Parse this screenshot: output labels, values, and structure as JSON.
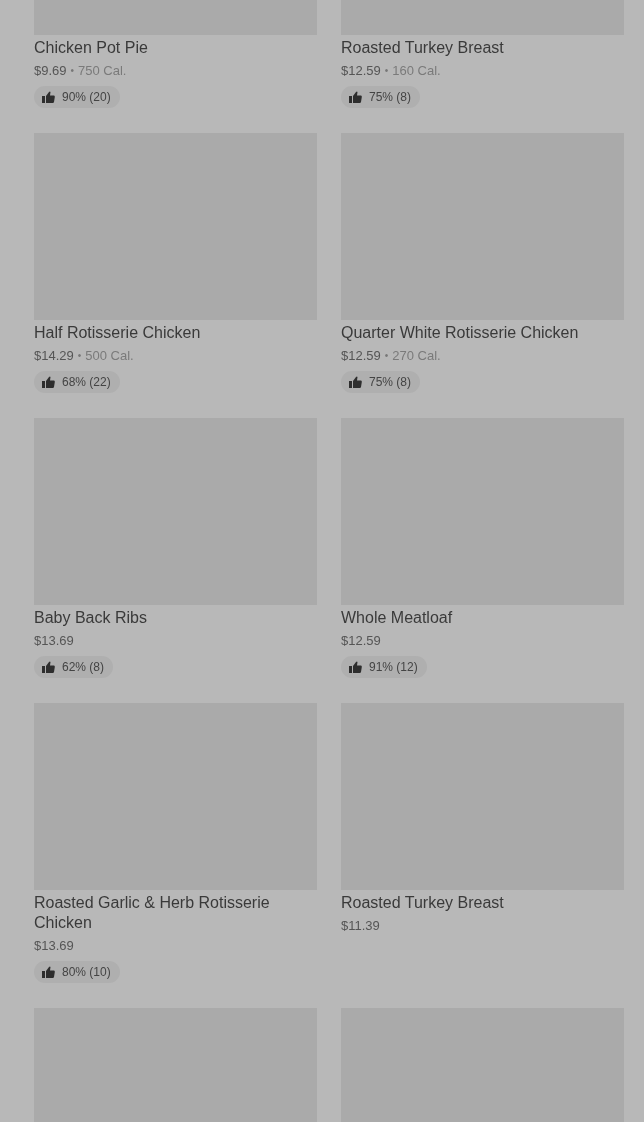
{
  "menu_items": [
    {
      "image": {
        "kind": "picture"
      },
      "name": "Chicken Pot Pie",
      "price": "$9.69",
      "separator": "•",
      "calories": "750 Cal.",
      "rating": "90% (20)"
    },
    {
      "image": {
        "kind": "picture"
      },
      "name": "Roasted Turkey Breast",
      "price": "$12.59",
      "separator": "•",
      "calories": "160 Cal.",
      "rating": "75% (8)"
    },
    {
      "image": {
        "kind": "picture"
      },
      "name": "Half Rotisserie Chicken",
      "price": "$14.29",
      "separator": "•",
      "calories": "500 Cal.",
      "rating": "68% (22)"
    },
    {
      "image": {
        "kind": "picture"
      },
      "name": "Quarter White Rotisserie Chicken",
      "price": "$12.59",
      "separator": "•",
      "calories": "270 Cal.",
      "rating": "75% (8)"
    },
    {
      "image": {
        "kind": "picture"
      },
      "name": "Baby Back Ribs",
      "price": "$13.69",
      "rating": "62% (8)"
    },
    {
      "image": {
        "kind": "picture"
      },
      "name": "Whole Meatloaf",
      "price": "$12.59",
      "rating": "91% (12)"
    },
    {
      "image": {
        "kind": "picture"
      },
      "name": "Roasted Garlic & Herb Rotisserie Chicken",
      "price": "$13.69",
      "rating": "80% (10)"
    },
    {
      "image": {
        "kind": "picture"
      },
      "name": "Roasted Turkey Breast",
      "price": "$11.39"
    },
    {
      "image": {
        "kind": "picture"
      }
    },
    {
      "image": {
        "kind": "picture"
      }
    }
  ]
}
